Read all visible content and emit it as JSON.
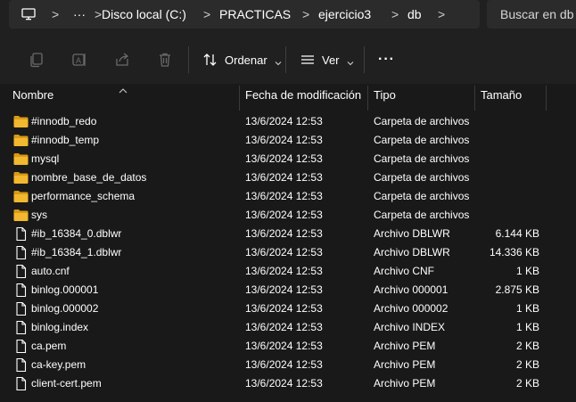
{
  "address_bar": {
    "segments": [
      "Disco local (C:)",
      "PRACTICAS",
      "ejercicio3",
      "db"
    ],
    "separator": ">",
    "more": "···"
  },
  "search": {
    "placeholder": "Buscar en db"
  },
  "toolbar": {
    "sort_label": "Ordenar",
    "view_label": "Ver",
    "more": "···"
  },
  "columns": {
    "name": "Nombre",
    "modified": "Fecha de modificación",
    "type": "Tipo",
    "size": "Tamaño"
  },
  "files": [
    {
      "name": "#innodb_redo",
      "modified": "13/6/2024 12:53",
      "type": "Carpeta de archivos",
      "size": "",
      "kind": "folder"
    },
    {
      "name": "#innodb_temp",
      "modified": "13/6/2024 12:53",
      "type": "Carpeta de archivos",
      "size": "",
      "kind": "folder"
    },
    {
      "name": "mysql",
      "modified": "13/6/2024 12:53",
      "type": "Carpeta de archivos",
      "size": "",
      "kind": "folder"
    },
    {
      "name": "nombre_base_de_datos",
      "modified": "13/6/2024 12:53",
      "type": "Carpeta de archivos",
      "size": "",
      "kind": "folder"
    },
    {
      "name": "performance_schema",
      "modified": "13/6/2024 12:53",
      "type": "Carpeta de archivos",
      "size": "",
      "kind": "folder"
    },
    {
      "name": "sys",
      "modified": "13/6/2024 12:53",
      "type": "Carpeta de archivos",
      "size": "",
      "kind": "folder"
    },
    {
      "name": "#ib_16384_0.dblwr",
      "modified": "13/6/2024 12:53",
      "type": "Archivo DBLWR",
      "size": "6.144 KB",
      "kind": "file"
    },
    {
      "name": "#ib_16384_1.dblwr",
      "modified": "13/6/2024 12:53",
      "type": "Archivo DBLWR",
      "size": "14.336 KB",
      "kind": "file"
    },
    {
      "name": "auto.cnf",
      "modified": "13/6/2024 12:53",
      "type": "Archivo CNF",
      "size": "1 KB",
      "kind": "file"
    },
    {
      "name": "binlog.000001",
      "modified": "13/6/2024 12:53",
      "type": "Archivo 000001",
      "size": "2.875 KB",
      "kind": "file"
    },
    {
      "name": "binlog.000002",
      "modified": "13/6/2024 12:53",
      "type": "Archivo 000002",
      "size": "1 KB",
      "kind": "file"
    },
    {
      "name": "binlog.index",
      "modified": "13/6/2024 12:53",
      "type": "Archivo INDEX",
      "size": "1 KB",
      "kind": "file"
    },
    {
      "name": "ca.pem",
      "modified": "13/6/2024 12:53",
      "type": "Archivo PEM",
      "size": "2 KB",
      "kind": "file"
    },
    {
      "name": "ca-key.pem",
      "modified": "13/6/2024 12:53",
      "type": "Archivo PEM",
      "size": "2 KB",
      "kind": "file"
    },
    {
      "name": "client-cert.pem",
      "modified": "13/6/2024 12:53",
      "type": "Archivo PEM",
      "size": "2 KB",
      "kind": "file"
    }
  ],
  "colors": {
    "folder": "#f2b82f",
    "folder_dark": "#d99a15",
    "file": "#ffffff"
  }
}
